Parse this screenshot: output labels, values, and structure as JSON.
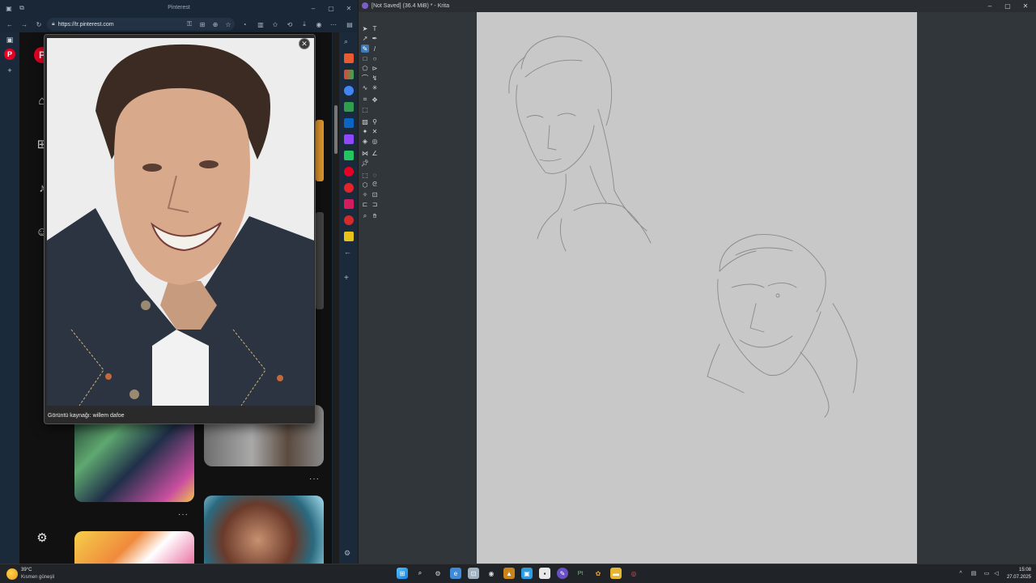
{
  "browser": {
    "tab_title": "Pinterest",
    "url": "https://tr.pinterest.com",
    "accent": "#e60023"
  },
  "pinterest": {
    "logo": "P",
    "popup_caption": "Görüntü kaynağı: willem dafoe",
    "more_label": "···"
  },
  "krita": {
    "title": "[Not Saved]  (36.4 MiB) * - Krita",
    "canvas_color": "#c8c8c8"
  },
  "taskbar": {
    "weather_temp": "39°C",
    "weather_desc": "Kısmen güneşli",
    "time": "15:08",
    "date": "27.07.2025"
  },
  "icons": [
    "window-icon",
    "pinterest-icon",
    "plus-icon",
    "back-icon",
    "forward-icon",
    "refresh-icon",
    "lock-icon",
    "star-icon",
    "settings-gear-icon",
    "close-icon",
    "brush-icon",
    "windows-start-icon",
    "search-icon",
    "chevron-up-icon"
  ]
}
